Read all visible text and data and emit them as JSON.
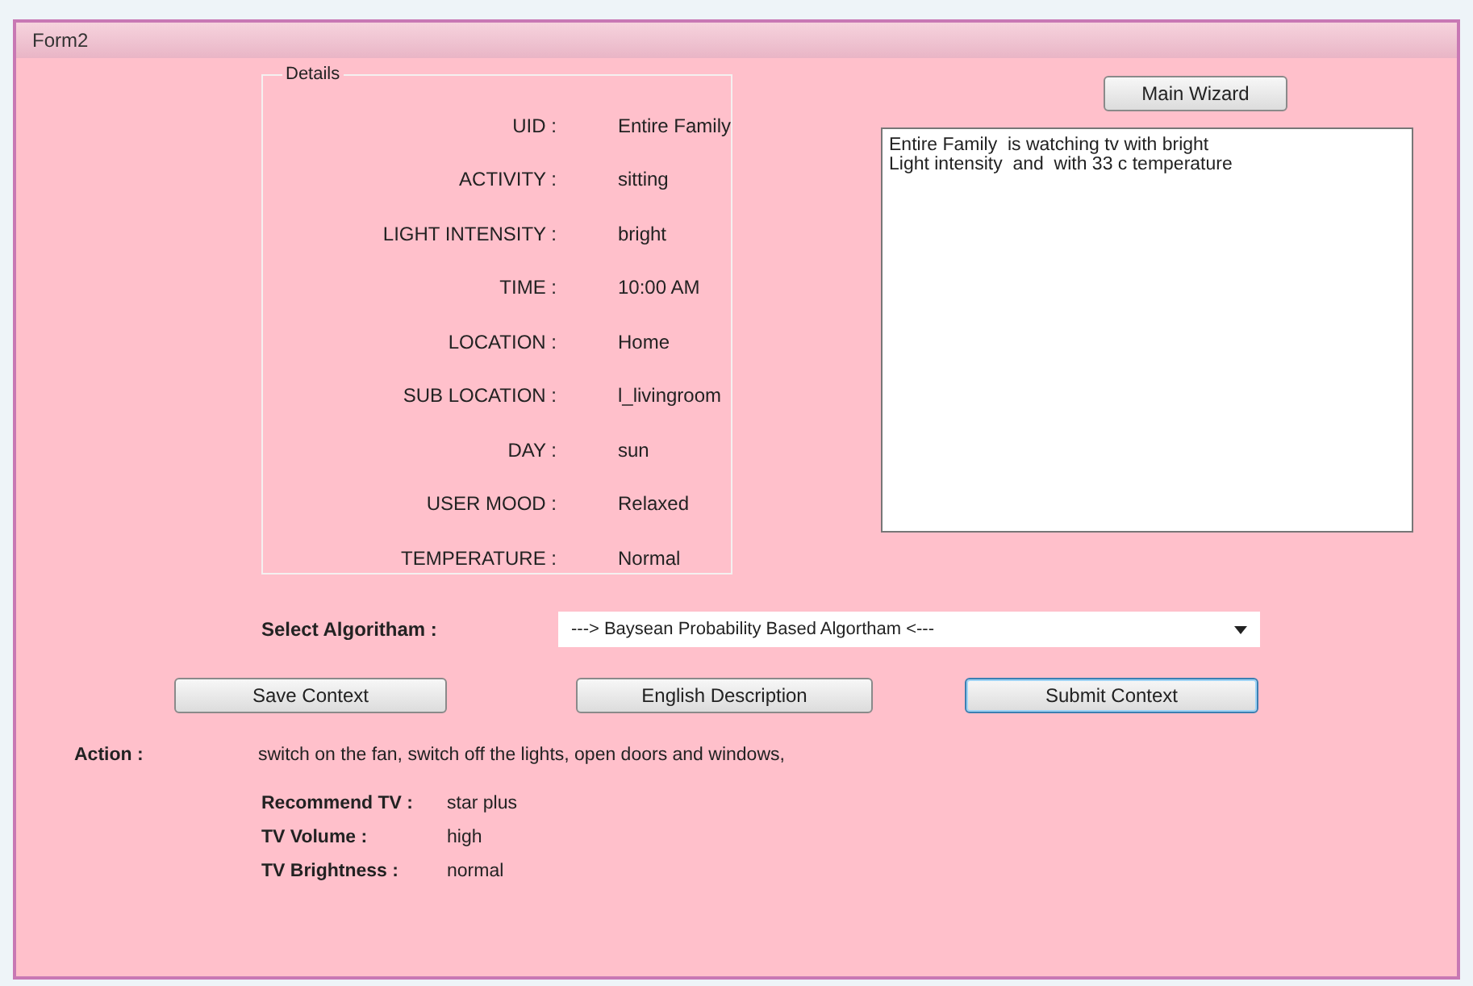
{
  "window": {
    "title": "Form2"
  },
  "details": {
    "legend": "Details",
    "fields": [
      {
        "label": "UID :",
        "value": "Entire Family"
      },
      {
        "label": "ACTIVITY :",
        "value": "sitting"
      },
      {
        "label": "LIGHT INTENSITY :",
        "value": "bright"
      },
      {
        "label": "TIME :",
        "value": "10:00 AM"
      },
      {
        "label": "LOCATION :",
        "value": "Home"
      },
      {
        "label": "SUB LOCATION :",
        "value": "l_livingroom"
      },
      {
        "label": "DAY :",
        "value": "sun"
      },
      {
        "label": "USER MOOD :",
        "value": "Relaxed"
      },
      {
        "label": "TEMPERATURE :",
        "value": "Normal"
      }
    ]
  },
  "main_wizard_button": "Main Wizard",
  "description_box": {
    "lines": [
      "Entire Family  is watching tv with bright",
      "Light intensity  and  with 33 c temperature"
    ]
  },
  "algorithm": {
    "label": "Select Algoritham :",
    "value": "---> Baysean Probability Based Algortham <---"
  },
  "buttons": [
    {
      "label": "Save Context",
      "focused": false
    },
    {
      "label": "English Description",
      "focused": false
    },
    {
      "label": "Submit Context",
      "focused": true
    }
  ],
  "action": {
    "label": "Action :",
    "value": "switch on the fan, switch off the lights, open doors and windows,"
  },
  "tv": [
    {
      "label": "Recommend TV :",
      "value": "star plus"
    },
    {
      "label": "TV Volume :",
      "value": "high"
    },
    {
      "label": "TV Brightness :",
      "value": "normal"
    }
  ]
}
